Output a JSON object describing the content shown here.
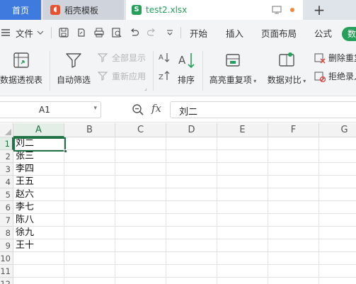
{
  "tabs": {
    "home": "首页",
    "template": "稻壳模板",
    "file": "test2.xlsx"
  },
  "menubar": {
    "file_label": "文件",
    "items": [
      "开始",
      "插入",
      "页面布局",
      "公式"
    ],
    "active_pill": "数据"
  },
  "ribbon": {
    "pivot": "数据透视表",
    "autofilter": "自动筛选",
    "show_all": "全部显示",
    "reapply": "重新应用",
    "sort": "排序",
    "highlight_dup": "高亮重复项",
    "data_compare": "数据对比",
    "remove_dup": "删除重复",
    "reject_dup": "拒绝录入"
  },
  "formula_bar": {
    "name_box": "A1",
    "fx": "fx",
    "value": "刘二"
  },
  "grid": {
    "columns": [
      "A",
      "B",
      "C",
      "D",
      "E",
      "F",
      "G"
    ],
    "rows": [
      "1",
      "2",
      "3",
      "4",
      "5",
      "6",
      "7",
      "8",
      "9",
      "10",
      "11",
      "12"
    ],
    "column_a_values": [
      "刘二",
      "张三",
      "李四",
      "王五",
      "赵六",
      "李七",
      "陈八",
      "徐九",
      "王十",
      "",
      "",
      ""
    ],
    "selected_cell": "A1"
  },
  "colors": {
    "home_tab": "#3f7bde",
    "accent_green": "#24a05a",
    "selection_green": "#217346"
  }
}
